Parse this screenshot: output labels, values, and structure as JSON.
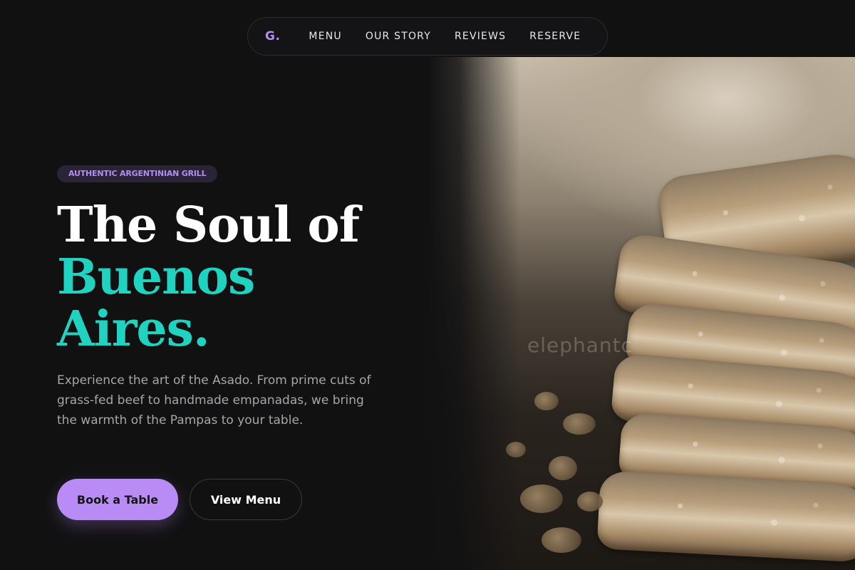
{
  "nav": {
    "logo": "G.",
    "links": [
      "MENU",
      "OUR STORY",
      "REVIEWS",
      "RESERVE"
    ]
  },
  "hero": {
    "badge": "AUTHENTIC ARGENTINIAN GRILL",
    "headline_line1": "The Soul of",
    "headline_accent_line1": "Buenos",
    "headline_accent_line2": "Aires.",
    "description": "Experience the art of the Asado. From prime cuts of grass-fed beef to handmade empanadas, we bring the warmth of the Pampas to your table.",
    "primary_button": "Book a Table",
    "secondary_button": "View Menu"
  },
  "image": {
    "subject": "stacked bread slices",
    "watermark": "elephantc"
  },
  "colors": {
    "background": "#111112",
    "accent_purple": "#b98cf5",
    "accent_teal": "#1fd3c0",
    "text_muted": "#a6a6ab"
  }
}
